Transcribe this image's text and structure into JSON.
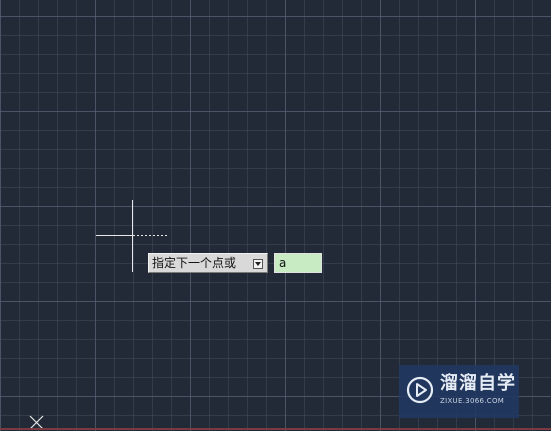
{
  "cad_canvas": {
    "background_color": "#212a36",
    "grid_major_color": "#5c687e",
    "grid_minor_color": "#404a5c"
  },
  "command_prompt": {
    "text": "指定下一个点或",
    "dropdown_icon": "down-arrow-icon"
  },
  "dynamic_input": {
    "value": "a",
    "background_color": "#c8ebc4"
  },
  "cursor": {
    "icon": "crosshair-cursor-icon",
    "color": "#e8e8e8"
  },
  "ucs": {
    "icon": "ucs-x-icon"
  },
  "watermark": {
    "title": "溜溜自学",
    "url": "ZIXUE.3066.COM",
    "icon": "play-logo-icon"
  }
}
